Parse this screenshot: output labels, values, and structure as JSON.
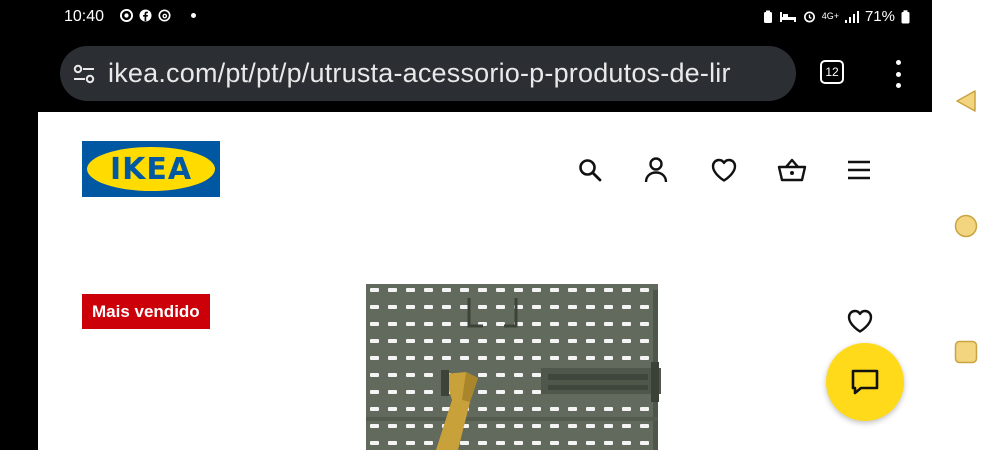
{
  "status_bar": {
    "time": "10:40",
    "network": "4G+",
    "battery": "71%",
    "notification_icons": [
      "chrome-icon",
      "facebook-icon",
      "threads-icon"
    ]
  },
  "browser": {
    "url_display": "ikea.com/pt/pt/p/utrusta-acessorio-p-produtos-de-lir",
    "tab_count": "12"
  },
  "site": {
    "logo_text": "IKEA",
    "header_icons": [
      "search-icon",
      "user-icon",
      "heart-icon",
      "basket-icon",
      "menu-icon"
    ]
  },
  "product": {
    "badge": "Mais vendido"
  },
  "colors": {
    "ikea_blue": "#0058a3",
    "ikea_yellow": "#ffdb00",
    "badge_red": "#cc0008",
    "chat_yellow": "#ffda1a"
  },
  "android_nav": [
    "back-button",
    "home-button",
    "recents-button"
  ]
}
